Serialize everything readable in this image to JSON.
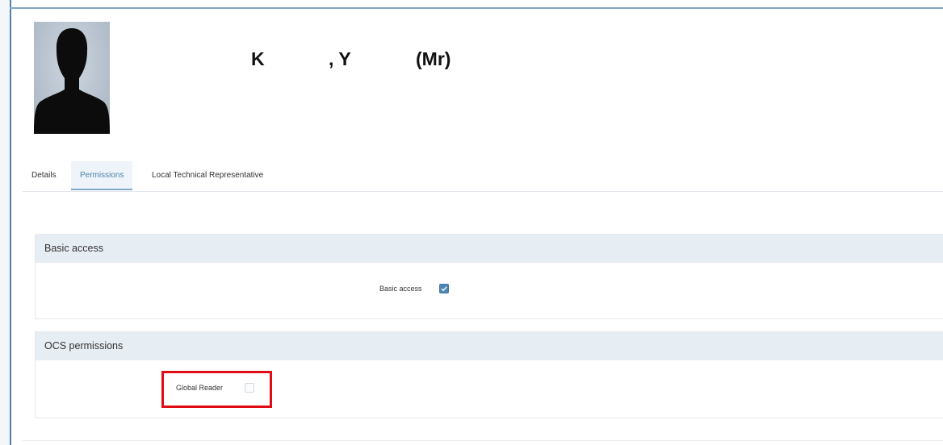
{
  "profile": {
    "surname": "K",
    "given_name": ", Y",
    "title": "(Mr)"
  },
  "tabs": [
    {
      "label": "Details",
      "active": false
    },
    {
      "label": "Permissions",
      "active": true
    },
    {
      "label": "Local Technical Representative",
      "active": false
    }
  ],
  "sections": {
    "basic": {
      "header": "Basic access",
      "field_label": "Basic access",
      "checked": true
    },
    "ocs": {
      "header": "OCS permissions",
      "field_label": "Global Reader",
      "checked": false
    }
  },
  "colors": {
    "accent": "#4f86b3",
    "panel_header_bg": "#e6edf3",
    "highlight": "#e00d15"
  }
}
